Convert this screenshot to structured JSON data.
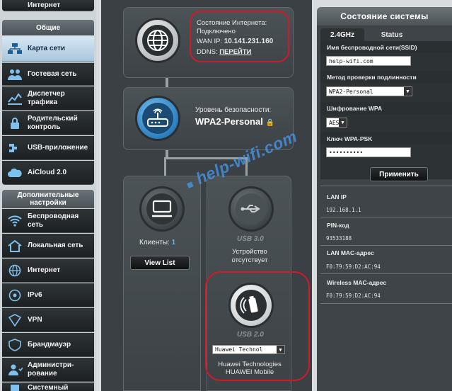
{
  "sidebar": {
    "top_item": "Интернет",
    "section_general": "Общие",
    "items_general": [
      {
        "label": "Карта сети",
        "icon": "network-map-icon",
        "active": true
      },
      {
        "label": "Гостевая сеть",
        "icon": "guest-network-icon"
      },
      {
        "label": "Диспетчер трафика",
        "icon": "traffic-manager-icon"
      },
      {
        "label": "Родительский контроль",
        "icon": "parental-control-icon"
      },
      {
        "label": "USB-приложение",
        "icon": "usb-app-icon"
      },
      {
        "label": "AiCloud 2.0",
        "icon": "aicloud-icon"
      }
    ],
    "section_advanced": "Дополнительные настройки",
    "items_advanced": [
      {
        "label": "Беспроводная сеть",
        "icon": "wireless-icon"
      },
      {
        "label": "Локальная сеть",
        "icon": "lan-home-icon"
      },
      {
        "label": "Интернет",
        "icon": "globe-icon"
      },
      {
        "label": "IPv6",
        "icon": "ipv6-icon"
      },
      {
        "label": "VPN",
        "icon": "vpn-icon"
      },
      {
        "label": "Брандмауэр",
        "icon": "firewall-icon"
      },
      {
        "label": "Администри- рование",
        "icon": "admin-icon"
      },
      {
        "label": "Системный",
        "icon": "syslog-icon"
      }
    ]
  },
  "internet": {
    "status_label": "Состояние Интернета:",
    "status_value": "Подключено",
    "wan_ip_label": "WAN IP:",
    "wan_ip": "10.141.231.160",
    "ddns_label": "DDNS:",
    "ddns_link": "ПЕРЕЙТИ"
  },
  "router": {
    "security_label": "Уровень безопасности:",
    "security_value": "WPA2-Personal"
  },
  "clients": {
    "label": "Клиенты:",
    "count": "1",
    "view_list": "View List"
  },
  "usb30": {
    "label": "USB 3.0",
    "status_line1": "Устройство",
    "status_line2": "отсутствует"
  },
  "usb20": {
    "label": "USB 2.0",
    "select_value": "Huawei Technol",
    "device_line1": "Huawei Technologies",
    "device_line2": "HUAWEI Mobile"
  },
  "watermark": "help-wifi.com",
  "system_status": {
    "title": "Состояние системы",
    "tabs": [
      "2.4GHz",
      "Status"
    ],
    "ssid_label": "Имя беспроводной сети(SSID)",
    "ssid_value": "help-wifi.com",
    "auth_label": "Метод проверки подлинности",
    "auth_value": "WPA2-Personal",
    "enc_label": "Шифрование WPA",
    "enc_value": "AES",
    "key_label": "Ключ WPA-PSK",
    "key_value": "••••••••••",
    "apply": "Применить",
    "lan_ip_label": "LAN IP",
    "lan_ip": "192.168.1.1",
    "pin_label": "PIN-код",
    "pin": "93533188",
    "lan_mac_label": "LAN MAC-адрес",
    "lan_mac": "F0:79:59:D2:AC:94",
    "wl_mac_label": "Wireless MAC-адрес",
    "wl_mac": "F0:79:59:D2:AC:94"
  },
  "colors": {
    "highlight_ring": "#d1192b",
    "watermark": "#4696eb",
    "active_sidebar": "#a9c6db",
    "client_count": "#5fb4f2"
  }
}
